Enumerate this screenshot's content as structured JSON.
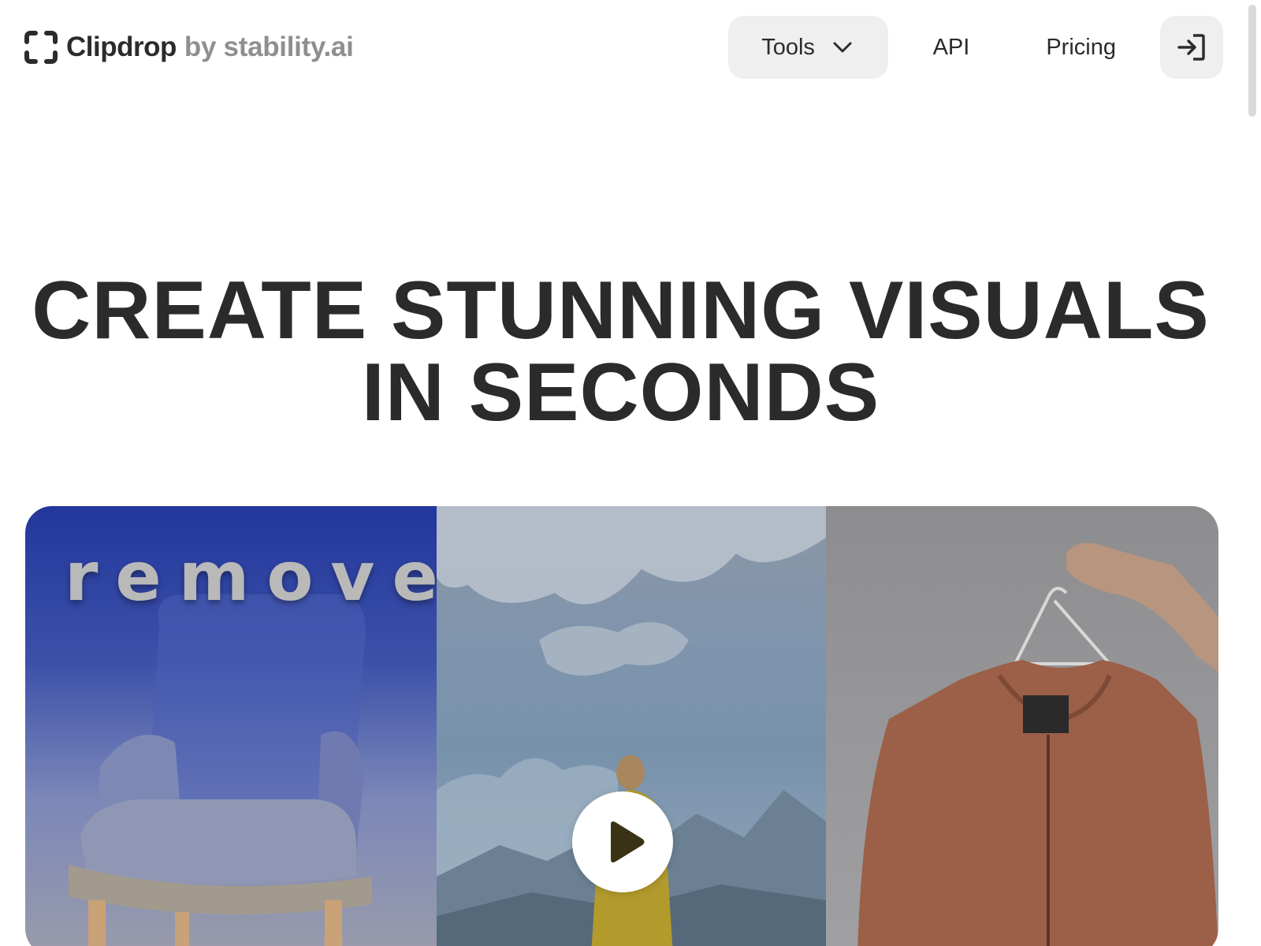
{
  "header": {
    "brand_name": "Clipdrop",
    "brand_by": "by stability.ai",
    "logo_icon": "clipdrop-frame-icon",
    "nav": {
      "tools_label": "Tools",
      "tools_icon": "chevron-down-icon",
      "api_label": "API",
      "pricing_label": "Pricing",
      "login_icon": "sign-in-icon"
    }
  },
  "hero": {
    "title_line1": "CREATE STUNNING VISUALS",
    "title_line2": "IN SECONDS"
  },
  "media": {
    "remove_word": "remove",
    "play_icon": "play-icon"
  },
  "colors": {
    "text": "#2b2b2b",
    "muted": "#8f8f8f",
    "button_bg": "#efefef",
    "play_triangle": "#3a3214"
  }
}
